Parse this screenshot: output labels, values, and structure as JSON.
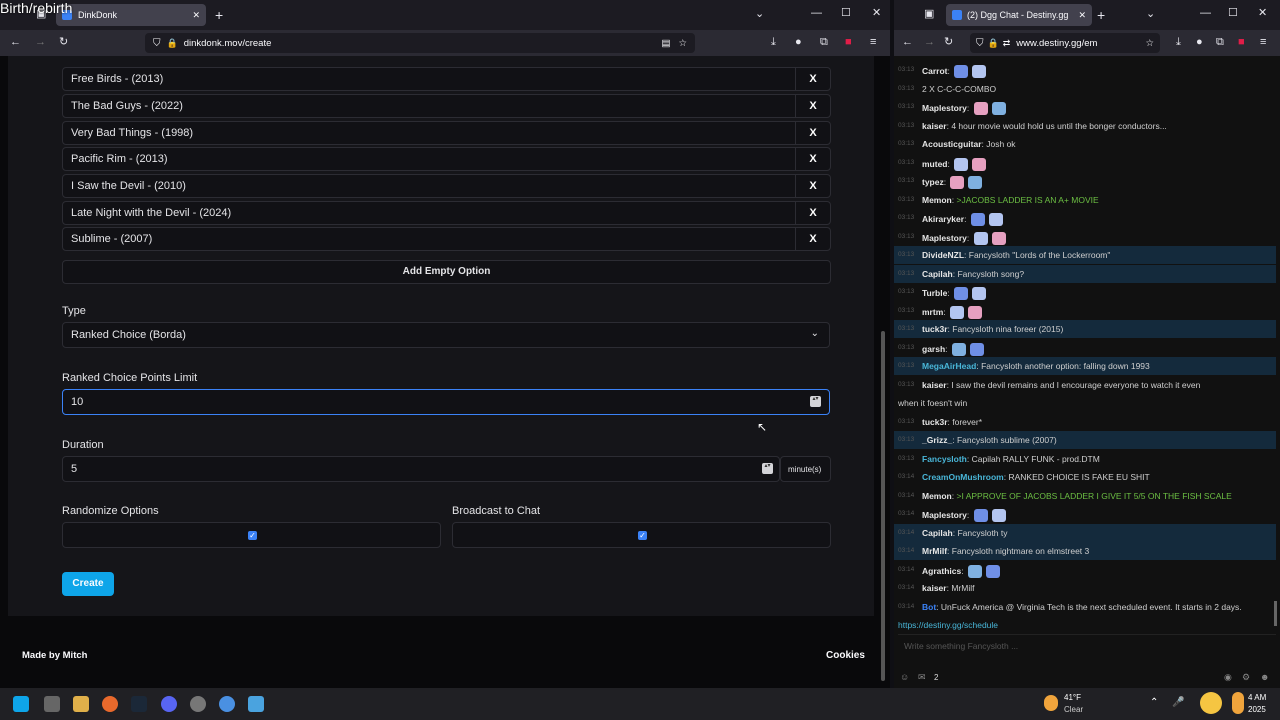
{
  "overlay_title": "Birth/rebirth",
  "left_browser": {
    "tab_title": "DinkDonk",
    "url": "dinkdonk.mov/create",
    "options": [
      "Free Birds - (2013)",
      "The Bad Guys - (2022)",
      "Very Bad Things - (1998)",
      "Pacific Rim - (2013)",
      "I Saw the Devil - (2010)",
      "Late Night with the Devil - (2024)",
      "Sublime - (2007)"
    ],
    "remove_label": "X",
    "add_empty_option": "Add Empty Option",
    "type_label": "Type",
    "type_value": "Ranked Choice (Borda)",
    "points_label": "Ranked Choice Points Limit",
    "points_value": "10",
    "duration_label": "Duration",
    "duration_value": "5",
    "duration_unit": "minute(s)",
    "randomize_label": "Randomize Options",
    "broadcast_label": "Broadcast to Chat",
    "create_label": "Create",
    "footer_left": "Made by Mitch",
    "footer_right": "Cookies"
  },
  "right_browser": {
    "tab_title": "(2) Dgg Chat - Destiny.gg",
    "url": "www.destiny.gg/em",
    "chat_input_placeholder": "Write something Fancysloth ...",
    "chat_count": "2",
    "messages": [
      {
        "time": "03:13",
        "nick": "Carrot",
        "text": "",
        "hl": false
      },
      {
        "time": "03:13",
        "nick": "",
        "text": "2 X C-C-C-COMBO",
        "hl": false
      },
      {
        "time": "03:13",
        "nick": "Maplestory",
        "text": "",
        "hl": false
      },
      {
        "time": "03:13",
        "nick": "kaiser",
        "text": "4 hour movie would hold us until the bonger conductors...",
        "hl": false
      },
      {
        "time": "03:13",
        "nick": "Acousticguitar",
        "text": "Josh ok",
        "hl": false
      },
      {
        "time": "03:13",
        "nick": "muted",
        "text": "",
        "hl": false
      },
      {
        "time": "03:13",
        "nick": "typez",
        "text": "",
        "hl": false
      },
      {
        "time": "03:13",
        "nick": "Memon",
        "text": ">JACOBS LADDER IS AN A+ MOVIE",
        "hl": false
      },
      {
        "time": "03:13",
        "nick": "Akiraryker",
        "text": "",
        "hl": false
      },
      {
        "time": "03:13",
        "nick": "Maplestory",
        "text": "",
        "hl": false
      },
      {
        "time": "03:13",
        "nick": "DivideNZL",
        "text": "Fancysloth \"Lords of the Lockerroom\"",
        "hl": true
      },
      {
        "time": "03:13",
        "nick": "Capilah",
        "text": "Fancysloth song?",
        "hl": true
      },
      {
        "time": "03:13",
        "nick": "Turble",
        "text": "",
        "hl": false
      },
      {
        "time": "03:13",
        "nick": "mrtm",
        "text": "",
        "hl": false
      },
      {
        "time": "03:13",
        "nick": "tuck3r",
        "text": "Fancysloth nina foreer (2015)",
        "hl": true
      },
      {
        "time": "03:13",
        "nick": "garsh",
        "text": "",
        "hl": false
      },
      {
        "time": "03:13",
        "nick": "MegaAirHead",
        "text": "Fancysloth another option: falling down 1993",
        "hl": true
      },
      {
        "time": "03:13",
        "nick": "kaiser",
        "text": "I saw the devil remains       and I encourage everyone to watch it even",
        "hl": false
      },
      {
        "time": "",
        "nick": "",
        "text": "when it foesn't win",
        "hl": false
      },
      {
        "time": "03:13",
        "nick": "tuck3r",
        "text": "forever*",
        "hl": false
      },
      {
        "time": "03:13",
        "nick": "_Grizz_",
        "text": "Fancysloth sublime (2007)",
        "hl": true
      },
      {
        "time": "03:13",
        "nick": "Fancysloth",
        "text": "Capilah RALLY FUNK - prod.DTM",
        "hl": false
      },
      {
        "time": "03:14",
        "nick": "CreamOnMushroom",
        "text": "RANKED CHOICE IS FAKE EU SHIT",
        "hl": false
      },
      {
        "time": "03:14",
        "nick": "Memon",
        "text": ">I APPROVE OF JACOBS LADDER     I GIVE IT 5/5 ON THE FISH SCALE",
        "hl": false
      },
      {
        "time": "03:14",
        "nick": "Maplestory",
        "text": "",
        "hl": false
      },
      {
        "time": "03:14",
        "nick": "Capilah",
        "text": "Fancysloth ty",
        "hl": true
      },
      {
        "time": "03:14",
        "nick": "MrMilf",
        "text": "Fancysloth nightmare on elmstreet 3",
        "hl": true
      },
      {
        "time": "03:14",
        "nick": "Agrathics",
        "text": "",
        "hl": false
      },
      {
        "time": "03:14",
        "nick": "kaiser",
        "text": "MrMilf",
        "hl": false
      },
      {
        "time": "03:14",
        "nick": "Bot",
        "text": "UnFuck America @ Virginia Tech is the next scheduled event. It starts in 2 days.",
        "hl": false
      },
      {
        "time": "",
        "nick": "",
        "text": "https://destiny.gg/schedule",
        "hl": false
      }
    ]
  },
  "taskbar": {
    "weather_temp": "41°F",
    "weather_desc": "Clear",
    "time": "4 AM",
    "year": "2025"
  },
  "colors": {
    "accent": "#0ea5e9",
    "chat_highlight": "#142a3c",
    "greentext": "#6cbf43"
  }
}
